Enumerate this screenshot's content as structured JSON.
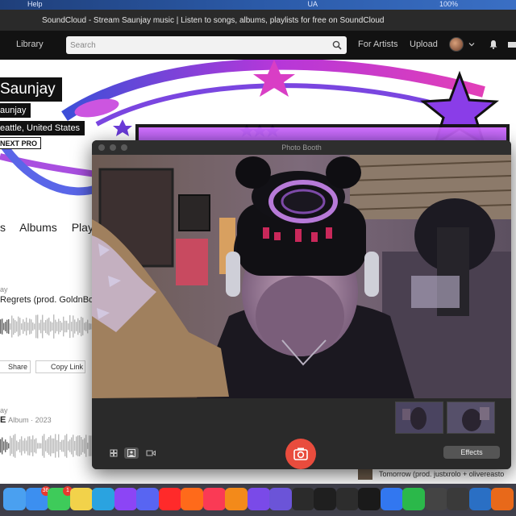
{
  "menubar": {
    "help": "Help",
    "battery": "100%",
    "status_text": "UA"
  },
  "browser": {
    "title": "SoundCloud - Stream Saunjay music | Listen to songs, albums, playlists for free on SoundCloud"
  },
  "header": {
    "library": "Library",
    "search_placeholder": "Search",
    "for_artists": "For Artists",
    "upload": "Upload"
  },
  "profile": {
    "name": "Saunjay",
    "username": "aunjay",
    "location": "eattle, United States",
    "badge": "NEXT PRO"
  },
  "tabs": [
    "s",
    "Albums",
    "Playl"
  ],
  "tracks": [
    {
      "artist": "ay",
      "title": "Regrets (prod. GoldnBo"
    },
    {
      "artist": "ay",
      "title": "E",
      "meta": "Album · 2023"
    }
  ],
  "actions": {
    "share": "Share",
    "copy_link": "Copy Link"
  },
  "side_track": "Tomorrow (prod. justxrolo + olivereasto",
  "photobooth": {
    "title": "Photo Booth",
    "effects": "Effects"
  },
  "dock": {
    "badges": {
      "mail": "36",
      "messages": "1"
    },
    "icons": [
      "finder-icon",
      "mail-icon",
      "messages-icon",
      "notes-icon",
      "telegram-icon",
      "twitch-icon",
      "discord-icon",
      "youtube-icon",
      "soundcloud-icon",
      "music-icon",
      "fl-studio-icon",
      "arc-icon",
      "affinity-icon",
      "chatgpt-icon",
      "github-icon",
      "unity-icon",
      "capcut-icon",
      "dropbox-icon",
      "numbers-icon",
      "audio-icon",
      "logic-icon",
      "vscode-icon",
      "fl-icon"
    ]
  },
  "colors": {
    "soundcloud_orange": "#ff5500",
    "shutter_red": "#e94c3d",
    "banner_magenta": "#c23cd8"
  }
}
